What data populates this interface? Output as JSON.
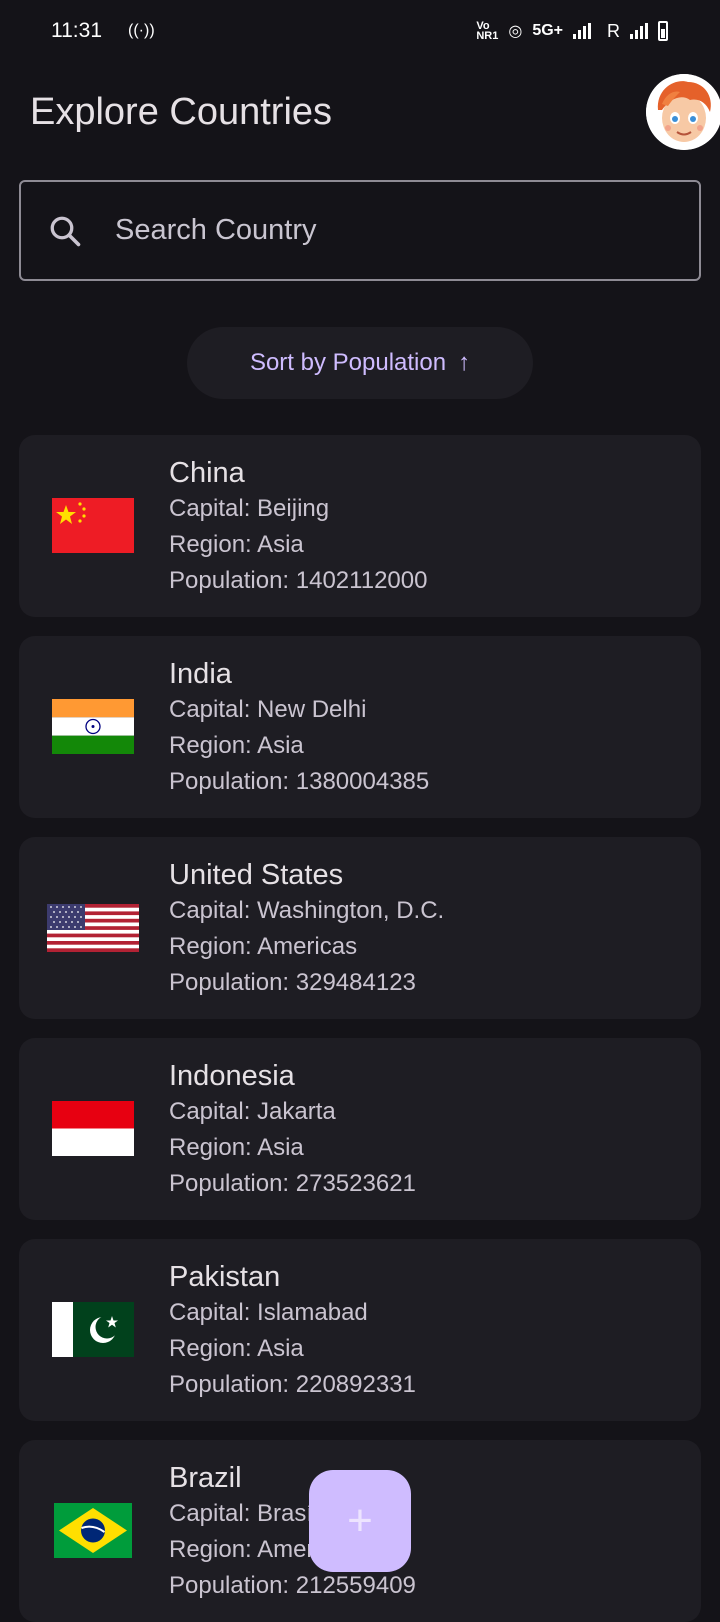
{
  "status_bar": {
    "time": "11:31",
    "network": "5G+",
    "roaming": "R"
  },
  "header": {
    "title": "Explore Countries"
  },
  "search": {
    "placeholder": "Search Country"
  },
  "sort": {
    "label": "Sort by Population",
    "arrow": "↑"
  },
  "countries": [
    {
      "name": "China",
      "capital": "Capital: Beijing",
      "region": "Region: Asia",
      "population": "Population: 1402112000",
      "flag": "china-flag-icon"
    },
    {
      "name": "India",
      "capital": "Capital: New Delhi",
      "region": "Region: Asia",
      "population": "Population: 1380004385",
      "flag": "india-flag-icon"
    },
    {
      "name": "United States",
      "capital": "Capital: Washington, D.C.",
      "region": "Region: Americas",
      "population": "Population: 329484123",
      "flag": "usa-flag-icon"
    },
    {
      "name": "Indonesia",
      "capital": "Capital: Jakarta",
      "region": "Region: Asia",
      "population": "Population: 273523621",
      "flag": "indonesia-flag-icon"
    },
    {
      "name": "Pakistan",
      "capital": "Capital: Islamabad",
      "region": "Region: Asia",
      "population": "Population: 220892331",
      "flag": "pakistan-flag-icon"
    },
    {
      "name": "Brazil",
      "capital": "Capital: Brasília",
      "region": "Region: Americas",
      "population": "Population: 212559409",
      "flag": "brazil-flag-icon"
    }
  ],
  "fab": {
    "icon": "+"
  },
  "colors": {
    "background": "#141318",
    "card": "#1e1d23",
    "accent": "#cfbcff"
  }
}
